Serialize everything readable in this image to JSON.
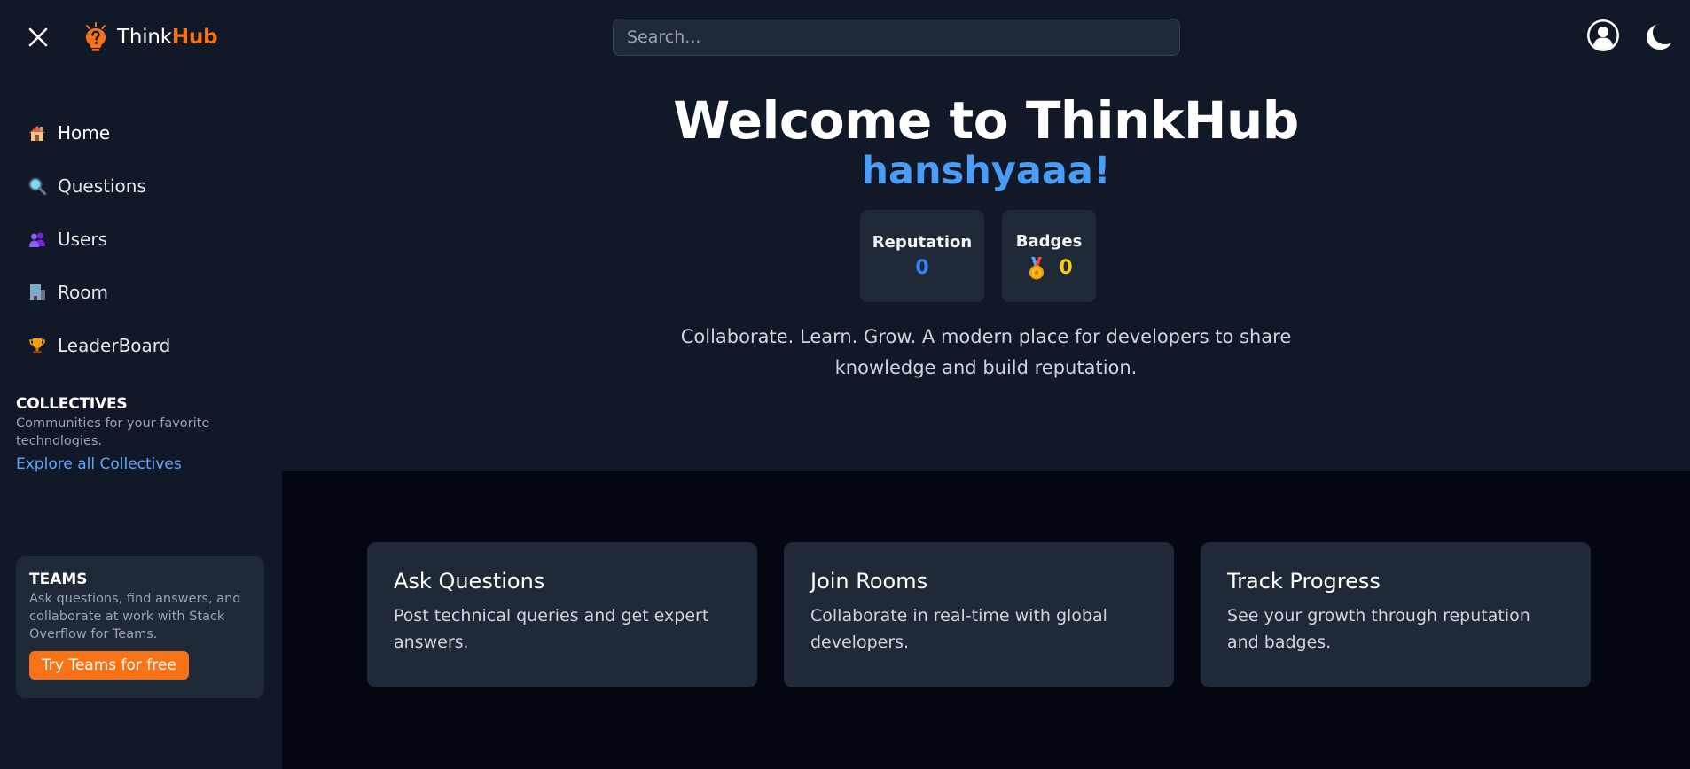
{
  "brand": {
    "name_part1": "Think",
    "name_part2": "Hub",
    "accent": "#f97316"
  },
  "header": {
    "search_placeholder": "Search...",
    "close_icon": "close-icon",
    "avatar_icon": "user-circle-icon",
    "theme_icon": "moon-icon"
  },
  "sidebar": {
    "items": [
      {
        "label": "Home",
        "icon": "house-emoji"
      },
      {
        "label": "Questions",
        "icon": "magnifier-emoji"
      },
      {
        "label": "Users",
        "icon": "people-emoji"
      },
      {
        "label": "Room",
        "icon": "office-building-emoji"
      },
      {
        "label": "LeaderBoard",
        "icon": "trophy-emoji"
      }
    ],
    "collectives": {
      "title": "COLLECTIVES",
      "description": "Communities for your favorite technologies.",
      "link": "Explore all Collectives"
    },
    "teams": {
      "title": "TEAMS",
      "description": "Ask questions, find answers, and collaborate at work with Stack Overflow for Teams.",
      "button": "Try Teams for free"
    }
  },
  "hero": {
    "title": "Welcome to ThinkHub",
    "username": "hanshyaaa!",
    "reputation_label": "Reputation",
    "reputation_value": "0",
    "badges_label": "Badges",
    "badges_value": "0",
    "description": "Collaborate. Learn. Grow. A modern place for developers to share knowledge and build reputation."
  },
  "features": [
    {
      "title": "Ask Questions",
      "description": "Post technical queries and get expert answers."
    },
    {
      "title": "Join Rooms",
      "description": "Collaborate in real-time with global developers."
    },
    {
      "title": "Track Progress",
      "description": "See your growth through reputation and badges."
    }
  ],
  "colors": {
    "background": "#111827",
    "card": "#1f2937",
    "features_background": "#030712",
    "link": "#60a5fa",
    "username": "#4a9cf7",
    "reputation": "#3b82f6",
    "badges": "#facc15"
  }
}
